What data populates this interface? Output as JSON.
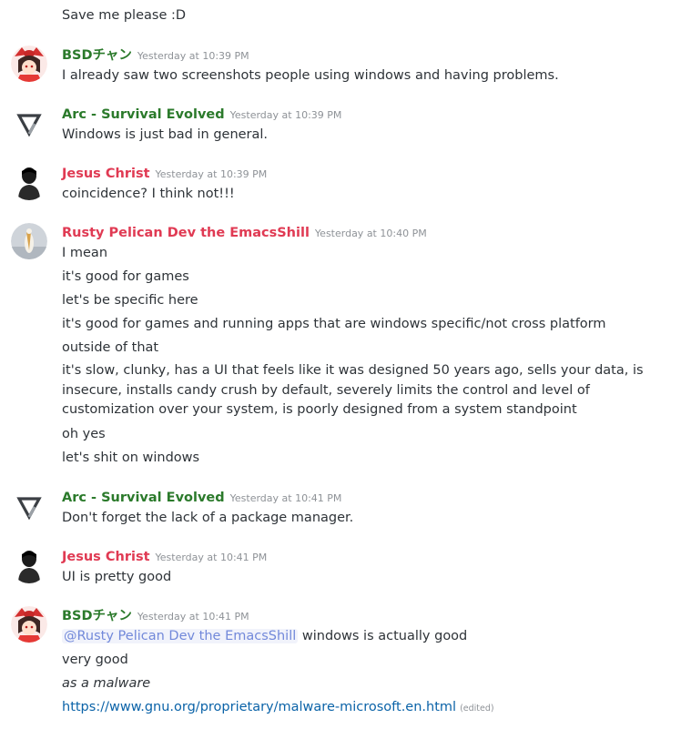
{
  "first_line": "Save me please :D",
  "groups": [
    {
      "author": "BSDチャン",
      "author_color": "#2b7a2b",
      "timestamp": "Yesterday at 10:39 PM",
      "avatar": "reimu-avatar",
      "lines": [
        "I already saw two screenshots people using windows and having problems."
      ]
    },
    {
      "author": "Arc - Survival Evolved",
      "author_color": "#2b7a2b",
      "timestamp": "Yesterday at 10:39 PM",
      "avatar": "arc-logo-avatar",
      "lines": [
        "Windows is just bad in general."
      ]
    },
    {
      "author": "Jesus Christ",
      "author_color": "#e03a53",
      "timestamp": "Yesterday at 10:39 PM",
      "avatar": "silhouette-avatar",
      "lines": [
        "coincidence? I think not!!!"
      ]
    },
    {
      "author": "Rusty Pelican Dev the EmacsShill",
      "author_color": "#e03a53",
      "timestamp": "Yesterday at 10:40 PM",
      "avatar": "pelican-avatar",
      "lines": [
        "I mean",
        "it's good for games",
        "let's be specific here",
        "it's good for games and running apps that are windows specific/not cross platform",
        "outside of that",
        "it's slow, clunky, has a UI that feels like it was designed 50 years ago, sells your data, is insecure, installs candy crush by default, severely limits the control and level of customization over your system, is poorly designed from a system standpoint",
        "oh yes",
        "let's shit on windows"
      ]
    },
    {
      "author": "Arc - Survival Evolved",
      "author_color": "#2b7a2b",
      "timestamp": "Yesterday at 10:41 PM",
      "avatar": "arc-logo-avatar",
      "lines": [
        "Don't forget the lack of a package manager."
      ]
    },
    {
      "author": "Jesus Christ",
      "author_color": "#e03a53",
      "timestamp": "Yesterday at 10:41 PM",
      "avatar": "silhouette-avatar",
      "lines": [
        "UI is pretty good"
      ]
    },
    {
      "author": "BSDチャン",
      "author_color": "#2b7a2b",
      "timestamp": "Yesterday at 10:41 PM",
      "avatar": "reimu-avatar",
      "mention": "@Rusty Pelican Dev the EmacsShill",
      "mention_tail": " windows is actually good",
      "lines": [
        "very good"
      ],
      "italic_line": "as a malware",
      "link": "https://www.gnu.org/proprietary/malware-microsoft.en.html",
      "edited": "(edited)"
    }
  ]
}
